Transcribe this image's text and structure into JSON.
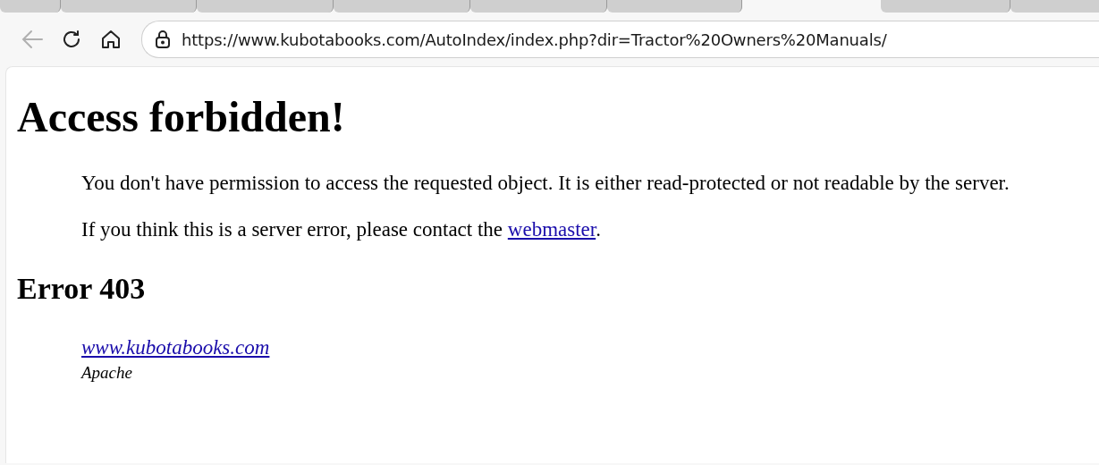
{
  "browser": {
    "tabs": [
      {
        "selected": false
      },
      {
        "selected": false
      },
      {
        "selected": false
      },
      {
        "selected": false
      },
      {
        "selected": false
      },
      {
        "selected": false
      },
      {
        "selected": true
      },
      {
        "selected": false
      },
      {
        "selected": false
      }
    ],
    "address": "https://www.kubotabooks.com/AutoIndex/index.php?dir=Tractor%20Owners%20Manuals/",
    "back_disabled": true
  },
  "page": {
    "title": "Access forbidden!",
    "paragraphs": [
      {
        "text": "You don't have permission to access the requested object. It is either read-protected or not readable by the server."
      },
      {
        "text": "If you think this is a server error, please contact the ",
        "link": "webmaster",
        "after": "."
      }
    ],
    "error_heading": "Error 403",
    "footer_link": "www.kubotabooks.com",
    "server": "Apache"
  }
}
